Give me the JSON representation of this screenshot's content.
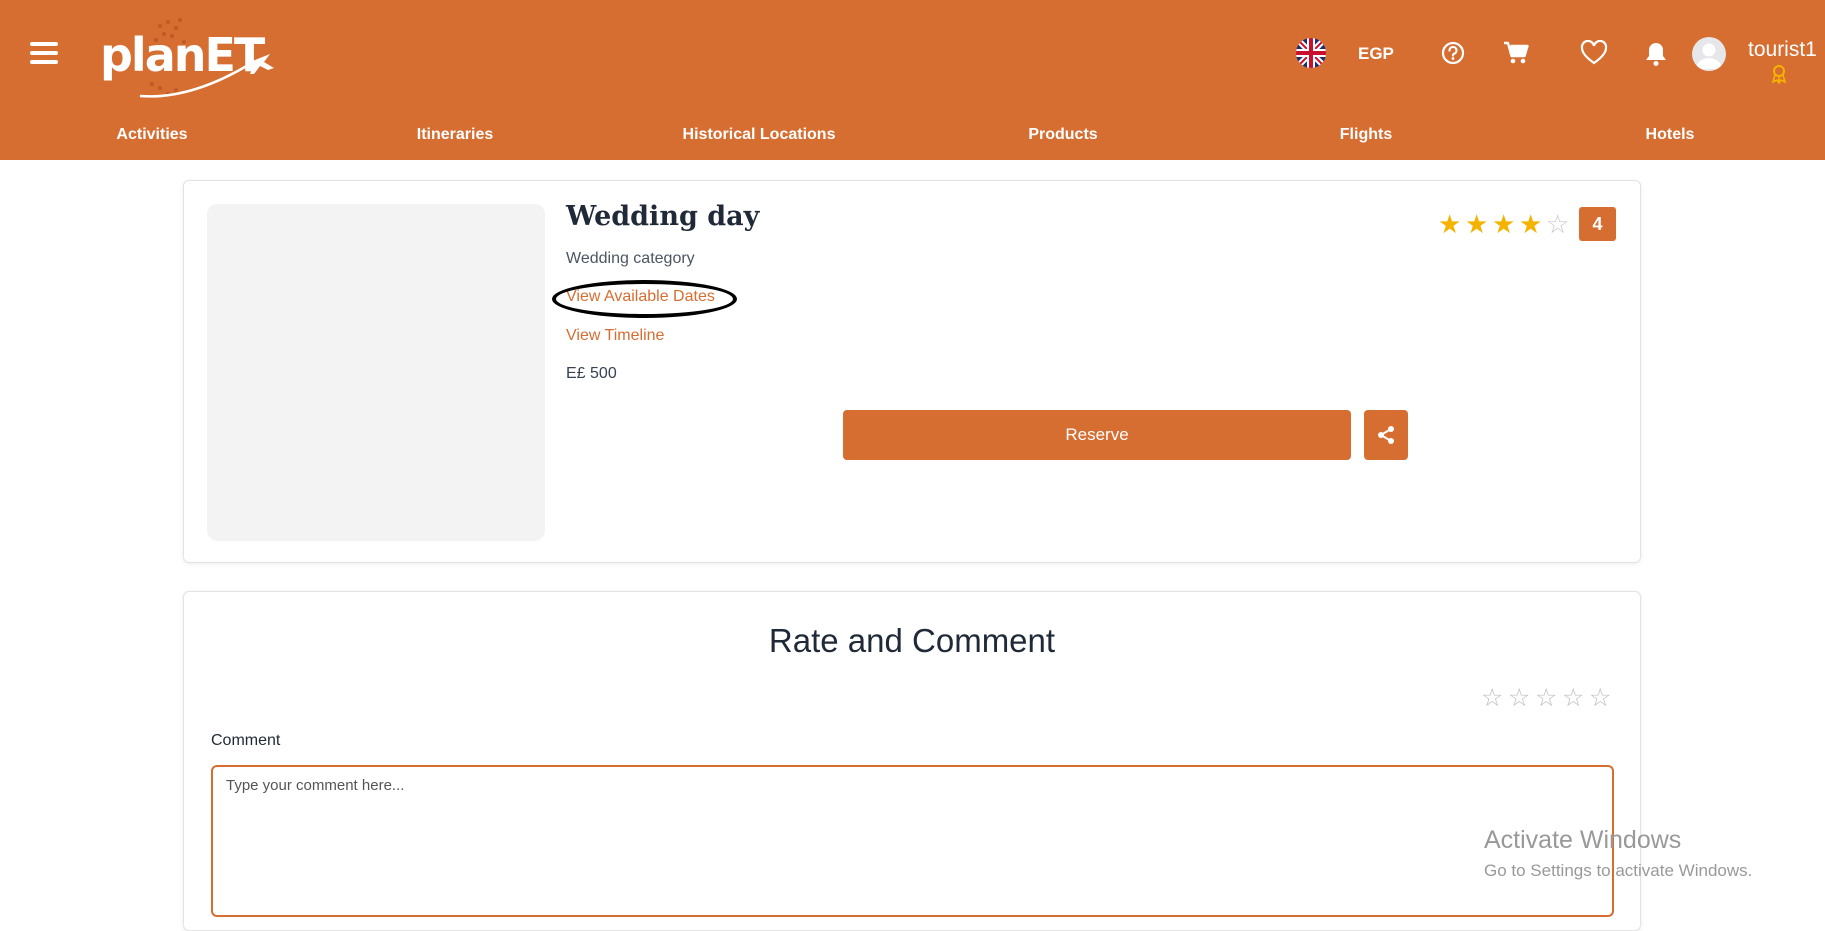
{
  "header": {
    "logo_text": "planET",
    "currency": "EGP",
    "username": "tourist1",
    "icons": [
      "menu-icon",
      "uk-flag-icon",
      "help-icon",
      "cart-icon",
      "heart-icon",
      "bell-icon",
      "avatar-icon",
      "badge-icon"
    ],
    "brand_color": "#d66d31"
  },
  "nav": {
    "items": [
      "Activities",
      "Itineraries",
      "Historical Locations",
      "Products",
      "Flights",
      "Hotels"
    ]
  },
  "activity": {
    "title": "Wedding day",
    "category": "Wedding category",
    "view_dates_label": "View Available Dates",
    "view_timeline_label": "View Timeline",
    "price": "E£ 500",
    "reserve_label": "Reserve",
    "rating": 4,
    "rating_max": 5,
    "rating_badge": "4"
  },
  "rate_section": {
    "title": "Rate and Comment",
    "stars_max": 5,
    "comment_label": "Comment",
    "comment_placeholder": "Type your comment here...",
    "comment_value": ""
  },
  "watermark": {
    "title": "Activate Windows",
    "subtitle": "Go to Settings to activate Windows."
  }
}
